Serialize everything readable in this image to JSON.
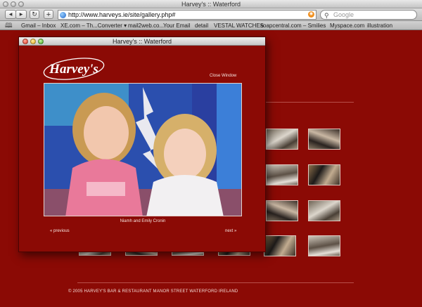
{
  "window": {
    "title": "Harvey's :: Waterford"
  },
  "toolbar": {
    "back_glyph": "◀",
    "forward_glyph": "▶",
    "reload_glyph": "↻",
    "add_glyph": "+",
    "url": "http://www.harveys.ie/site/gallery.php#",
    "search_placeholder": "Google"
  },
  "bookmarks": [
    "Gmail – Inbox",
    "XE.com – Th...Converter ▾",
    "mail2web.co...",
    "Your Email",
    "detail",
    "VESTAL WATCHES",
    "soapcentral.com – Smilies",
    "Myspace.com",
    "illustration"
  ],
  "popup": {
    "title": "Harvey's :: Waterford",
    "logo_text": "Harvey's",
    "close_label": "Close Window",
    "caption": "Niamh and Emily Cronin",
    "prev_label": "« previous",
    "next_label": "next »"
  },
  "footer": {
    "text": "© 2005 HARVEY'S BAR & RESTAURANT  MANOR STREET  WATERFORD  IRELAND"
  },
  "colors": {
    "page_background": "#8b0a05",
    "accent_text": "#f6e3de"
  }
}
